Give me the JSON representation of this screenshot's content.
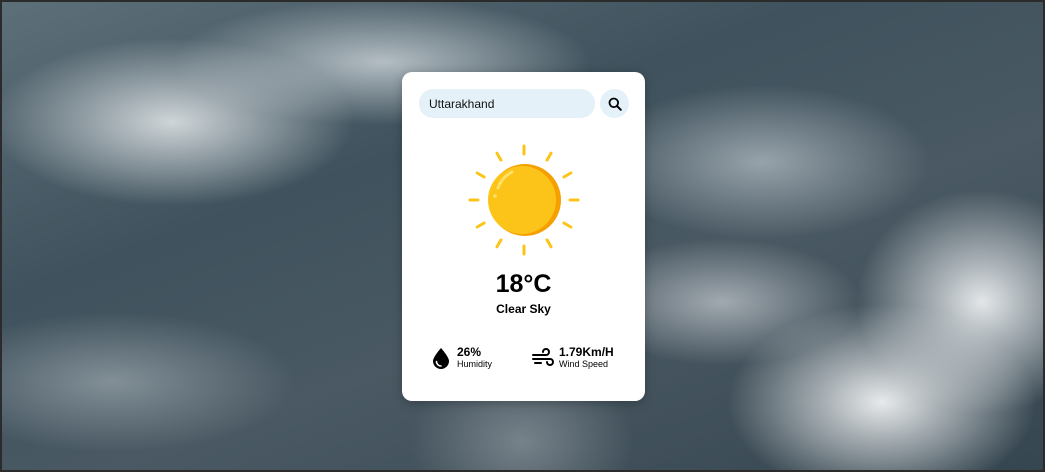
{
  "search": {
    "value": "Uttarakhand"
  },
  "weather": {
    "temperature": "18°C",
    "condition": "Clear Sky",
    "icon": "sun-icon"
  },
  "humidity": {
    "value": "26%",
    "label": "Humidity",
    "icon": "water-drop-icon"
  },
  "wind": {
    "value": "1.79Km/H",
    "label": "Wind Speed",
    "icon": "wind-icon"
  },
  "colors": {
    "card_bg": "#ffffff",
    "input_bg": "#e4f1f9",
    "sun": "#fcc419",
    "sun_shade": "#f59f00"
  }
}
